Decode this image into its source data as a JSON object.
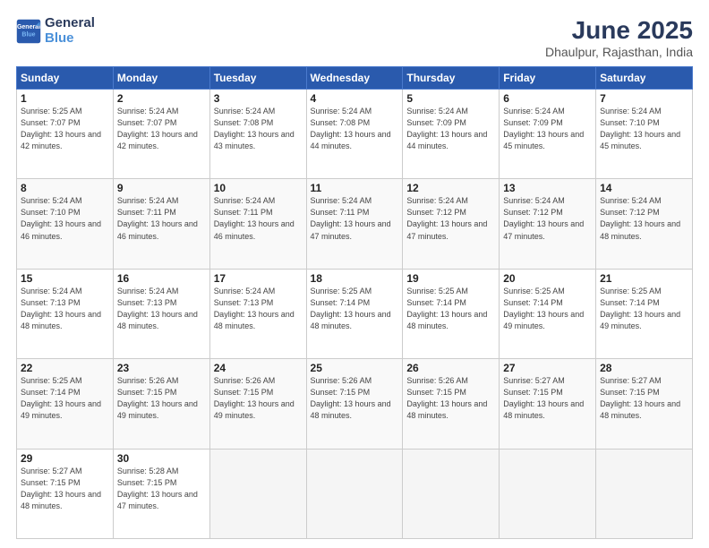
{
  "logo": {
    "line1": "General",
    "line2": "Blue"
  },
  "title": "June 2025",
  "location": "Dhaulpur, Rajasthan, India",
  "weekdays": [
    "Sunday",
    "Monday",
    "Tuesday",
    "Wednesday",
    "Thursday",
    "Friday",
    "Saturday"
  ],
  "days": [
    {
      "num": "1",
      "rise": "5:25 AM",
      "set": "7:07 PM",
      "daylight": "13 hours and 42 minutes."
    },
    {
      "num": "2",
      "rise": "5:24 AM",
      "set": "7:07 PM",
      "daylight": "13 hours and 42 minutes."
    },
    {
      "num": "3",
      "rise": "5:24 AM",
      "set": "7:08 PM",
      "daylight": "13 hours and 43 minutes."
    },
    {
      "num": "4",
      "rise": "5:24 AM",
      "set": "7:08 PM",
      "daylight": "13 hours and 44 minutes."
    },
    {
      "num": "5",
      "rise": "5:24 AM",
      "set": "7:09 PM",
      "daylight": "13 hours and 44 minutes."
    },
    {
      "num": "6",
      "rise": "5:24 AM",
      "set": "7:09 PM",
      "daylight": "13 hours and 45 minutes."
    },
    {
      "num": "7",
      "rise": "5:24 AM",
      "set": "7:10 PM",
      "daylight": "13 hours and 45 minutes."
    },
    {
      "num": "8",
      "rise": "5:24 AM",
      "set": "7:10 PM",
      "daylight": "13 hours and 46 minutes."
    },
    {
      "num": "9",
      "rise": "5:24 AM",
      "set": "7:11 PM",
      "daylight": "13 hours and 46 minutes."
    },
    {
      "num": "10",
      "rise": "5:24 AM",
      "set": "7:11 PM",
      "daylight": "13 hours and 46 minutes."
    },
    {
      "num": "11",
      "rise": "5:24 AM",
      "set": "7:11 PM",
      "daylight": "13 hours and 47 minutes."
    },
    {
      "num": "12",
      "rise": "5:24 AM",
      "set": "7:12 PM",
      "daylight": "13 hours and 47 minutes."
    },
    {
      "num": "13",
      "rise": "5:24 AM",
      "set": "7:12 PM",
      "daylight": "13 hours and 47 minutes."
    },
    {
      "num": "14",
      "rise": "5:24 AM",
      "set": "7:12 PM",
      "daylight": "13 hours and 48 minutes."
    },
    {
      "num": "15",
      "rise": "5:24 AM",
      "set": "7:13 PM",
      "daylight": "13 hours and 48 minutes."
    },
    {
      "num": "16",
      "rise": "5:24 AM",
      "set": "7:13 PM",
      "daylight": "13 hours and 48 minutes."
    },
    {
      "num": "17",
      "rise": "5:24 AM",
      "set": "7:13 PM",
      "daylight": "13 hours and 48 minutes."
    },
    {
      "num": "18",
      "rise": "5:25 AM",
      "set": "7:14 PM",
      "daylight": "13 hours and 48 minutes."
    },
    {
      "num": "19",
      "rise": "5:25 AM",
      "set": "7:14 PM",
      "daylight": "13 hours and 48 minutes."
    },
    {
      "num": "20",
      "rise": "5:25 AM",
      "set": "7:14 PM",
      "daylight": "13 hours and 49 minutes."
    },
    {
      "num": "21",
      "rise": "5:25 AM",
      "set": "7:14 PM",
      "daylight": "13 hours and 49 minutes."
    },
    {
      "num": "22",
      "rise": "5:25 AM",
      "set": "7:14 PM",
      "daylight": "13 hours and 49 minutes."
    },
    {
      "num": "23",
      "rise": "5:26 AM",
      "set": "7:15 PM",
      "daylight": "13 hours and 49 minutes."
    },
    {
      "num": "24",
      "rise": "5:26 AM",
      "set": "7:15 PM",
      "daylight": "13 hours and 49 minutes."
    },
    {
      "num": "25",
      "rise": "5:26 AM",
      "set": "7:15 PM",
      "daylight": "13 hours and 48 minutes."
    },
    {
      "num": "26",
      "rise": "5:26 AM",
      "set": "7:15 PM",
      "daylight": "13 hours and 48 minutes."
    },
    {
      "num": "27",
      "rise": "5:27 AM",
      "set": "7:15 PM",
      "daylight": "13 hours and 48 minutes."
    },
    {
      "num": "28",
      "rise": "5:27 AM",
      "set": "7:15 PM",
      "daylight": "13 hours and 48 minutes."
    },
    {
      "num": "29",
      "rise": "5:27 AM",
      "set": "7:15 PM",
      "daylight": "13 hours and 48 minutes."
    },
    {
      "num": "30",
      "rise": "5:28 AM",
      "set": "7:15 PM",
      "daylight": "13 hours and 47 minutes."
    }
  ]
}
